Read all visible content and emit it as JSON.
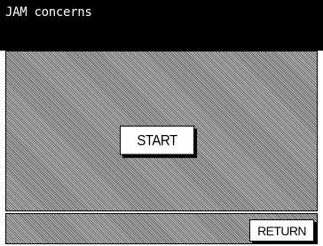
{
  "header": {
    "title": "JAM concerns"
  },
  "main": {
    "start_label": "START"
  },
  "footer": {
    "return_label": "RETURN"
  },
  "colors": {
    "title_bar": "#000000",
    "title_text": "#ffffff",
    "button_face": "#ffffff",
    "hatch_light": "#c8c8c8",
    "hatch_dark": "#5a5a5a"
  }
}
